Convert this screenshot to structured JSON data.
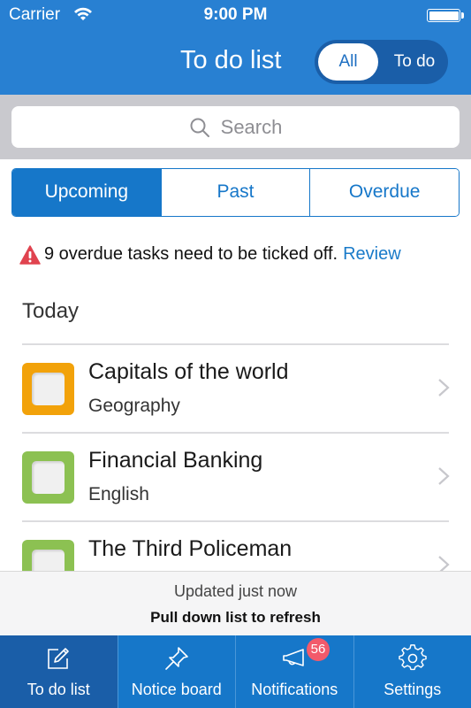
{
  "status_bar": {
    "carrier": "Carrier",
    "time": "9:00 PM"
  },
  "header": {
    "title": "To do list",
    "filter_toggle": {
      "options": [
        "All",
        "To do"
      ],
      "selected": "All"
    }
  },
  "search": {
    "placeholder": "Search"
  },
  "segments": {
    "items": [
      "Upcoming",
      "Past",
      "Overdue"
    ],
    "selected": "Upcoming"
  },
  "alert": {
    "message": "9 overdue tasks need to be ticked off.",
    "link": "Review"
  },
  "sections": [
    {
      "title": "Today",
      "tasks": [
        {
          "title": "Capitals of the world",
          "subject": "Geography",
          "color": "#f2a20a"
        },
        {
          "title": "Financial Banking",
          "subject": "English",
          "color": "#8cc152"
        },
        {
          "title": "The Third Policeman",
          "subject": "",
          "color": "#8cc152"
        }
      ]
    }
  ],
  "refresh": {
    "status": "Updated just now",
    "hint": "Pull down list to refresh"
  },
  "tabbar": {
    "items": [
      {
        "label": "To do list",
        "icon": "edit-icon",
        "active": true
      },
      {
        "label": "Notice board",
        "icon": "pin-icon",
        "active": false
      },
      {
        "label": "Notifications",
        "icon": "megaphone-icon",
        "active": false,
        "badge": "56"
      },
      {
        "label": "Settings",
        "icon": "gear-icon",
        "active": false
      }
    ]
  },
  "colors": {
    "primary": "#2880d2",
    "accent": "#1677c9",
    "alert": "#e0434f",
    "badge": "#f25a6b"
  }
}
